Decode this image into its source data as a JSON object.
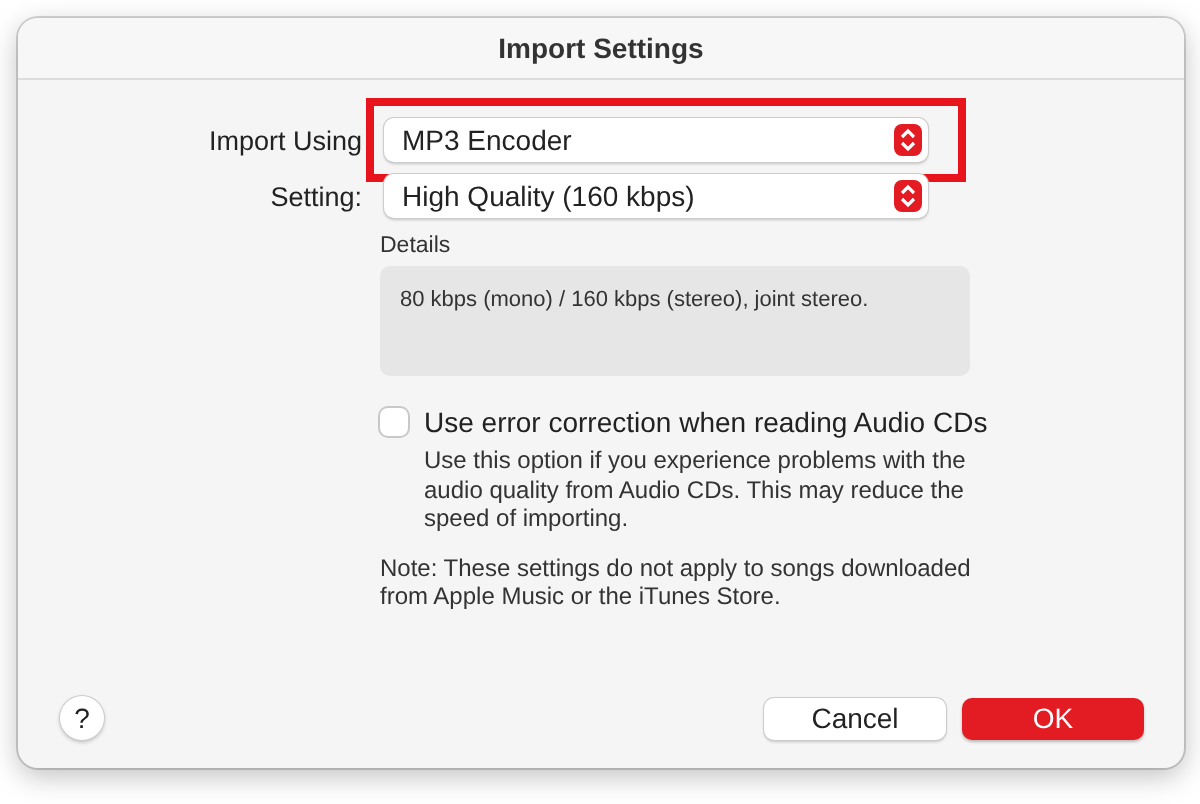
{
  "window": {
    "title": "Import Settings"
  },
  "fields": [
    {
      "label": "Import Using",
      "value": "MP3 Encoder",
      "highlighted": true
    },
    {
      "label": "Setting:",
      "value": "High Quality (160 kbps)",
      "highlighted": false
    }
  ],
  "details": {
    "label": "Details",
    "text": "80 kbps (mono) / 160 kbps (stereo), joint stereo."
  },
  "error_correction": {
    "label": "Use error correction when reading Audio CDs",
    "checked": false,
    "description": "Use this option if you experience problems with the audio quality from Audio CDs. This may reduce the speed of importing."
  },
  "note": "Note: These settings do not apply to songs downloaded from Apple Music or the iTunes Store.",
  "help": "?",
  "buttons": [
    {
      "label": "Cancel",
      "kind": "secondary"
    },
    {
      "label": "OK",
      "kind": "primary"
    }
  ]
}
